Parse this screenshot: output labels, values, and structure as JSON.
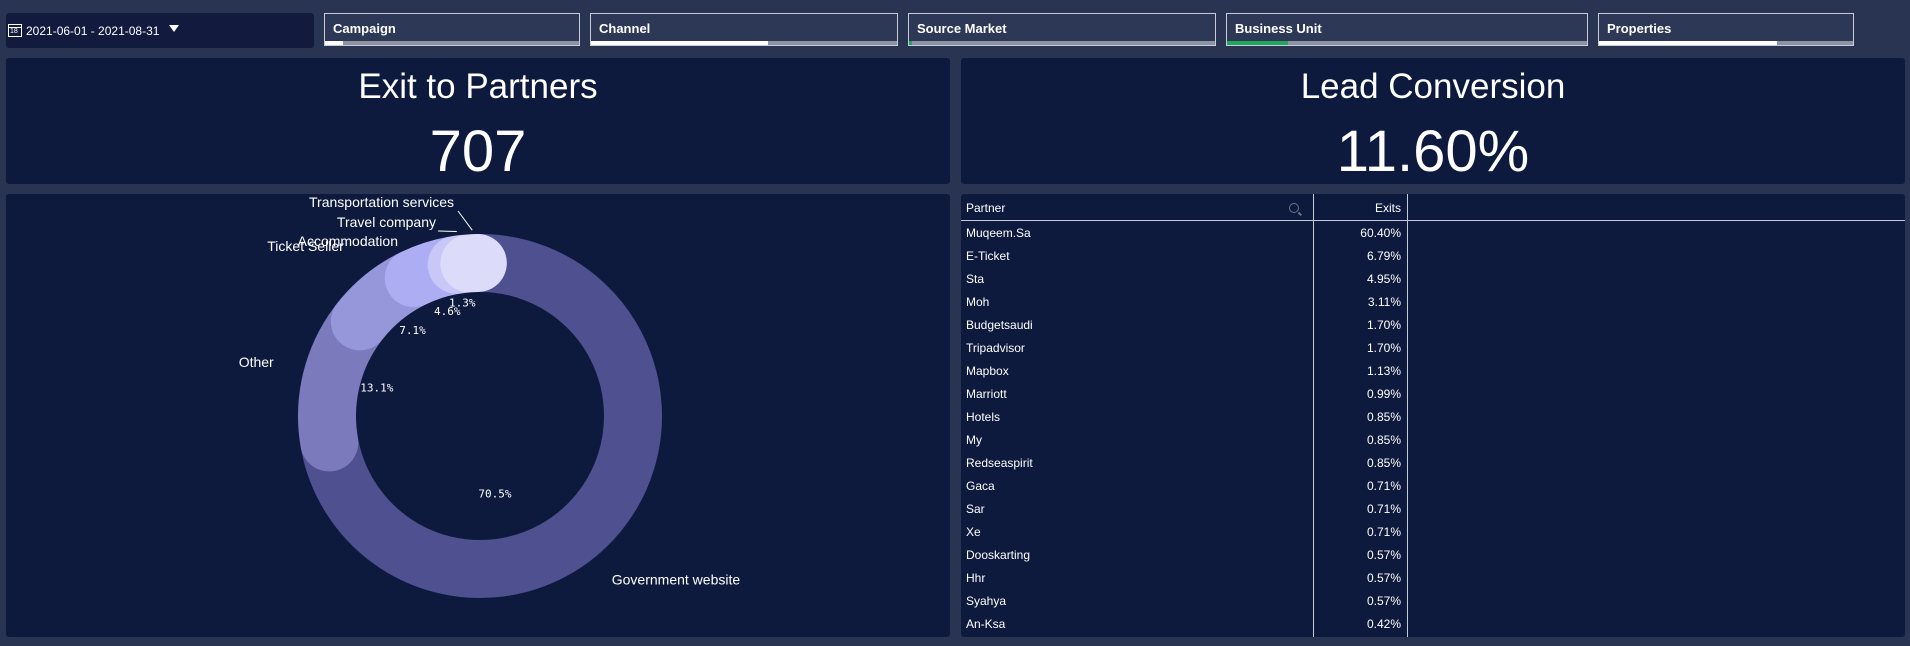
{
  "date_filter": {
    "icon": "calendar-icon",
    "calendar_glyph": "18",
    "range": "2021-06-01 - 2021-08-31"
  },
  "filters": [
    {
      "label": "Campaign",
      "fill_fraction": 0.07,
      "fill_color": "#ffffff"
    },
    {
      "label": "Channel",
      "fill_fraction": 0.58,
      "fill_color": "#ffffff"
    },
    {
      "label": "Source Market",
      "fill_fraction": 0.01,
      "fill_color": "#1fa65a"
    },
    {
      "label": "Business Unit",
      "fill_fraction": 0.17,
      "fill_color": "#1fa65a"
    },
    {
      "label": "Properties",
      "fill_fraction": 0.7,
      "fill_color": "#ffffff"
    }
  ],
  "kpis": {
    "exits": {
      "title": "Exit to Partners",
      "value": "707"
    },
    "lead": {
      "title": "Lead Conversion",
      "value": "11.60%"
    }
  },
  "chart_data": {
    "type": "pie",
    "donut": true,
    "categories": [
      "Government website",
      "Other",
      "Ticket Seller",
      "Accommodation",
      "Travel company",
      "Transportation services"
    ],
    "values": [
      70.5,
      13.1,
      7.1,
      4.6,
      1.3,
      1.3
    ],
    "value_labels": [
      "70.5%",
      "13.1%",
      "7.1%",
      "4.6%",
      "1.3%",
      ""
    ],
    "colors": [
      "#4e5090",
      "#7a7abd",
      "#9696da",
      "#adadf4",
      "#c8c8f8",
      "#dcdcfa"
    ],
    "title": ""
  },
  "table": {
    "col_partner": "Partner",
    "col_exits": "Exits",
    "rows": [
      {
        "partner": "Muqeem.Sa",
        "exits": "60.40%"
      },
      {
        "partner": "E-Ticket",
        "exits": "6.79%"
      },
      {
        "partner": "Sta",
        "exits": "4.95%"
      },
      {
        "partner": "Moh",
        "exits": "3.11%"
      },
      {
        "partner": "Budgetsaudi",
        "exits": "1.70%"
      },
      {
        "partner": "Tripadvisor",
        "exits": "1.70%"
      },
      {
        "partner": "Mapbox",
        "exits": "1.13%"
      },
      {
        "partner": "Marriott",
        "exits": "0.99%"
      },
      {
        "partner": "Hotels",
        "exits": "0.85%"
      },
      {
        "partner": "My",
        "exits": "0.85%"
      },
      {
        "partner": "Redseaspirit",
        "exits": "0.85%"
      },
      {
        "partner": "Gaca",
        "exits": "0.71%"
      },
      {
        "partner": "Sar",
        "exits": "0.71%"
      },
      {
        "partner": "Xe",
        "exits": "0.71%"
      },
      {
        "partner": "Dooskarting",
        "exits": "0.57%"
      },
      {
        "partner": "Hhr",
        "exits": "0.57%"
      },
      {
        "partner": "Syahya",
        "exits": "0.57%"
      },
      {
        "partner": "An-Ksa",
        "exits": "0.42%"
      }
    ]
  }
}
